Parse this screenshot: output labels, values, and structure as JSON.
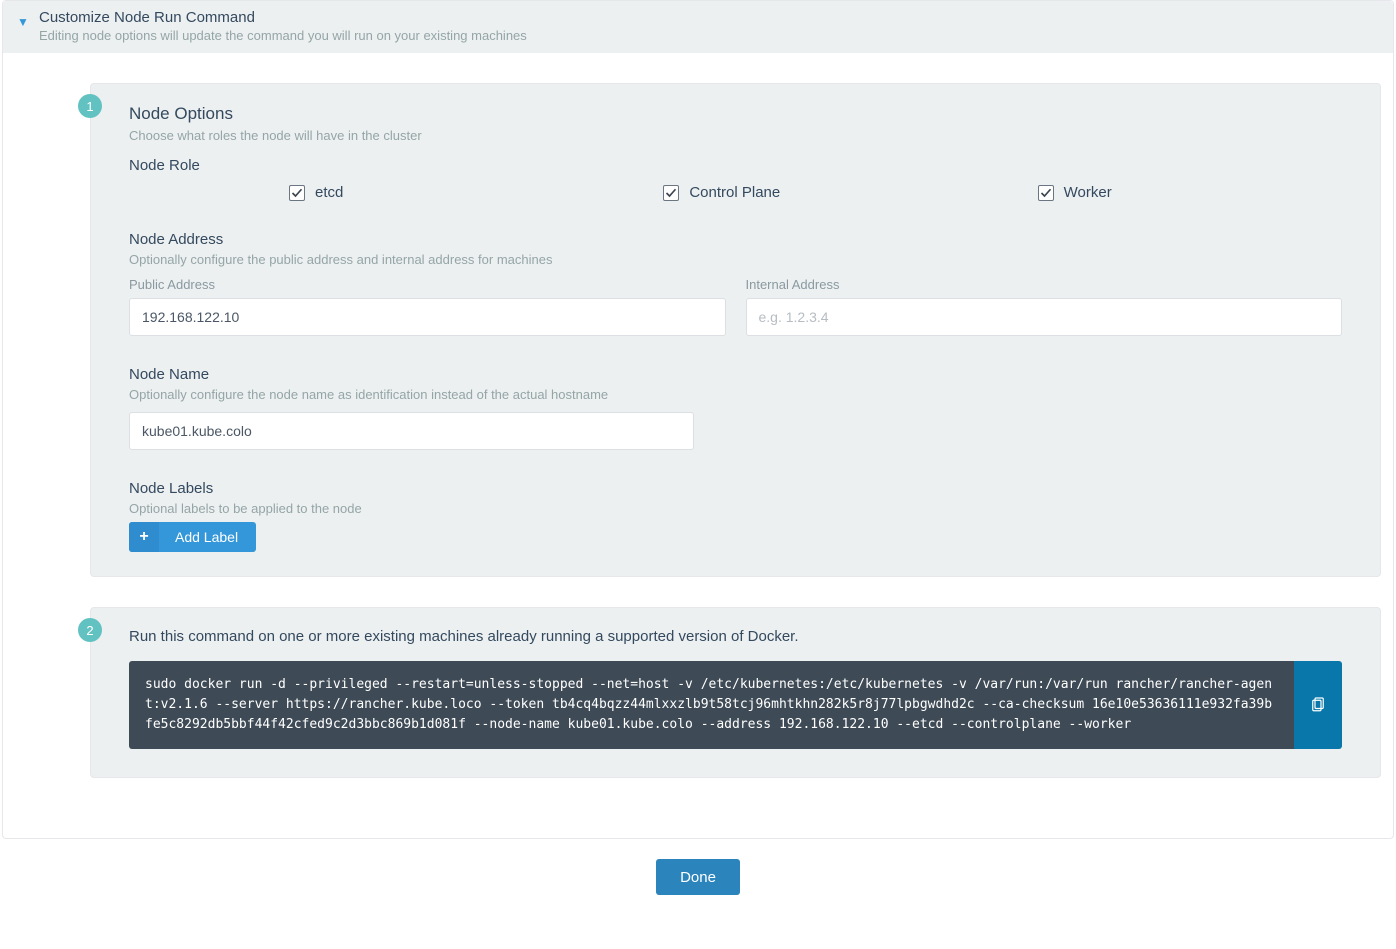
{
  "header": {
    "title": "Customize Node Run Command",
    "subtitle": "Editing node options will update the command you will run on your existing machines"
  },
  "steps": {
    "step1_badge": "1",
    "step2_badge": "2"
  },
  "node_options": {
    "title": "Node Options",
    "subtitle": "Choose what roles the node will have in the cluster"
  },
  "node_role": {
    "title": "Node Role",
    "roles": [
      {
        "label": "etcd",
        "checked": true
      },
      {
        "label": "Control Plane",
        "checked": true
      },
      {
        "label": "Worker",
        "checked": true
      }
    ]
  },
  "node_address": {
    "title": "Node Address",
    "subtitle": "Optionally configure the public address and internal address for machines",
    "public_label": "Public Address",
    "public_value": "192.168.122.10",
    "internal_label": "Internal Address",
    "internal_placeholder": "e.g. 1.2.3.4",
    "internal_value": ""
  },
  "node_name": {
    "title": "Node Name",
    "subtitle": "Optionally configure the node name as identification instead of the actual hostname",
    "value": "kube01.kube.colo"
  },
  "node_labels": {
    "title": "Node Labels",
    "subtitle": "Optional labels to be applied to the node",
    "add_label_button": "Add Label"
  },
  "step2": {
    "title": "Run this command on one or more existing machines already running a supported version of Docker.",
    "command": "sudo docker run -d --privileged --restart=unless-stopped --net=host -v /etc/kubernetes:/etc/kubernetes -v /var/run:/var/run rancher/rancher-agent:v2.1.6 --server https://rancher.kube.loco --token tb4cq4bqzz44mlxxzlb9t58tcj96mhtkhn282k5r8j77lpbgwdhd2c --ca-checksum 16e10e53636111e932fa39bfe5c8292db5bbf44f42cfed9c2d3bbc869b1d081f --node-name kube01.kube.colo --address 192.168.122.10 --etcd --controlplane --worker"
  },
  "footer": {
    "done_label": "Done"
  }
}
